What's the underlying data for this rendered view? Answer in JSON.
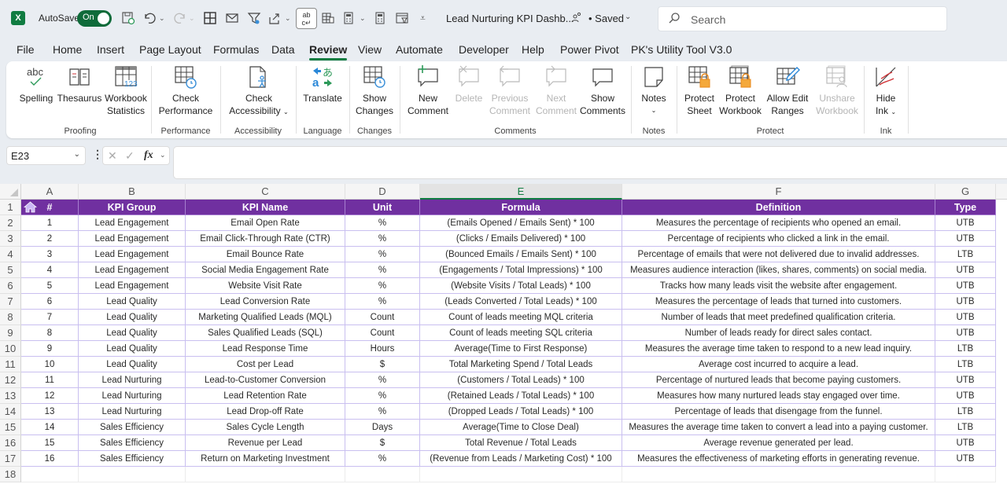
{
  "titlebar": {
    "app_icon": "excel-logo-icon",
    "app_letter": "X",
    "autosave_label": "AutoSave",
    "autosave_state": "On",
    "document_title": "Lead Nurturing KPI Dashb...",
    "save_status": "• Saved",
    "search_placeholder": "Search"
  },
  "tabs": [
    {
      "label": "File"
    },
    {
      "label": "Home"
    },
    {
      "label": "Insert"
    },
    {
      "label": "Page Layout"
    },
    {
      "label": "Formulas"
    },
    {
      "label": "Data"
    },
    {
      "label": "Review",
      "active": true
    },
    {
      "label": "View"
    },
    {
      "label": "Automate"
    },
    {
      "label": "Developer"
    },
    {
      "label": "Help"
    },
    {
      "label": "Power Pivot"
    },
    {
      "label": "PK's Utility Tool V3.0"
    }
  ],
  "ribbon": {
    "groups": {
      "proofing": "Proofing",
      "performance": "Performance",
      "accessibility": "Accessibility",
      "language": "Language",
      "changes": "Changes",
      "comments": "Comments",
      "notes": "Notes",
      "protect": "Protect",
      "ink": "Ink"
    },
    "buttons": {
      "spelling": "Spelling",
      "thesaurus": "Thesaurus",
      "workbook_statistics_1": "Workbook",
      "workbook_statistics_2": "Statistics",
      "check_performance_1": "Check",
      "check_performance_2": "Performance",
      "check_accessibility_1": "Check",
      "check_accessibility_2": "Accessibility",
      "translate": "Translate",
      "show_changes_1": "Show",
      "show_changes_2": "Changes",
      "new_comment_1": "New",
      "new_comment_2": "Comment",
      "delete_comment": "Delete",
      "previous_comment_1": "Previous",
      "previous_comment_2": "Comment",
      "next_comment_1": "Next",
      "next_comment_2": "Comment",
      "show_comments_1": "Show",
      "show_comments_2": "Comments",
      "notes": "Notes",
      "protect_sheet_1": "Protect",
      "protect_sheet_2": "Sheet",
      "protect_workbook_1": "Protect",
      "protect_workbook_2": "Workbook",
      "allow_edit_ranges_1": "Allow Edit",
      "allow_edit_ranges_2": "Ranges",
      "unshare_workbook_1": "Unshare",
      "unshare_workbook_2": "Workbook",
      "hide_ink_1": "Hide",
      "hide_ink_2": "Ink"
    }
  },
  "formula_bar": {
    "name_box": "E23",
    "formula": ""
  },
  "sheet": {
    "column_letters": [
      "A",
      "B",
      "C",
      "D",
      "E",
      "F",
      "G"
    ],
    "selected_column": "E",
    "row_numbers": [
      "1",
      "2",
      "3",
      "4",
      "5",
      "6",
      "7",
      "8",
      "9",
      "10",
      "11",
      "12",
      "13",
      "14",
      "15",
      "16",
      "17",
      "18"
    ],
    "header_color": "#7030a0",
    "headers": [
      "#",
      "KPI Group",
      "KPI Name",
      "Unit",
      "Formula",
      "Definition",
      "Type"
    ],
    "rows": [
      [
        "1",
        "Lead Engagement",
        "Email Open Rate",
        "%",
        "(Emails Opened / Emails Sent) * 100",
        "Measures the percentage of recipients who opened an email.",
        "UTB"
      ],
      [
        "2",
        "Lead Engagement",
        "Email Click-Through Rate (CTR)",
        "%",
        "(Clicks / Emails Delivered) * 100",
        "Percentage of recipients who clicked a link in the email.",
        "UTB"
      ],
      [
        "3",
        "Lead Engagement",
        "Email Bounce Rate",
        "%",
        "(Bounced Emails / Emails Sent) * 100",
        "Percentage of emails that were not delivered due to invalid addresses.",
        "LTB"
      ],
      [
        "4",
        "Lead Engagement",
        "Social Media Engagement Rate",
        "%",
        "(Engagements / Total Impressions) * 100",
        "Measures audience interaction (likes, shares, comments) on social media.",
        "UTB"
      ],
      [
        "5",
        "Lead Engagement",
        "Website Visit Rate",
        "%",
        "(Website Visits / Total Leads) * 100",
        "Tracks how many leads visit the website after engagement.",
        "UTB"
      ],
      [
        "6",
        "Lead Quality",
        "Lead Conversion Rate",
        "%",
        "(Leads Converted / Total Leads) * 100",
        "Measures the percentage of leads that turned into customers.",
        "UTB"
      ],
      [
        "7",
        "Lead Quality",
        "Marketing Qualified Leads (MQL)",
        "Count",
        "Count of leads meeting MQL criteria",
        "Number of leads that meet predefined qualification criteria.",
        "UTB"
      ],
      [
        "8",
        "Lead Quality",
        "Sales Qualified Leads (SQL)",
        "Count",
        "Count of leads meeting SQL criteria",
        "Number of leads ready for direct sales contact.",
        "UTB"
      ],
      [
        "9",
        "Lead Quality",
        "Lead Response Time",
        "Hours",
        "Average(Time to First Response)",
        "Measures the average time taken to respond to a new lead inquiry.",
        "LTB"
      ],
      [
        "10",
        "Lead Quality",
        "Cost per Lead",
        "$",
        "Total Marketing Spend / Total Leads",
        "Average cost incurred to acquire a lead.",
        "LTB"
      ],
      [
        "11",
        "Lead Nurturing",
        "Lead-to-Customer Conversion",
        "%",
        "(Customers / Total Leads) * 100",
        "Percentage of nurtured leads that become paying customers.",
        "UTB"
      ],
      [
        "12",
        "Lead Nurturing",
        "Lead Retention Rate",
        "%",
        "(Retained Leads / Total Leads) * 100",
        "Measures how many nurtured leads stay engaged over time.",
        "UTB"
      ],
      [
        "13",
        "Lead Nurturing",
        "Lead Drop-off Rate",
        "%",
        "(Dropped Leads / Total Leads) * 100",
        "Percentage of leads that disengage from the funnel.",
        "LTB"
      ],
      [
        "14",
        "Sales Efficiency",
        "Sales Cycle Length",
        "Days",
        "Average(Time to Close Deal)",
        "Measures the average time taken to convert a lead into a paying customer.",
        "LTB"
      ],
      [
        "15",
        "Sales Efficiency",
        "Revenue per Lead",
        "$",
        "Total Revenue / Total Leads",
        "Average revenue generated per lead.",
        "UTB"
      ],
      [
        "16",
        "Sales Efficiency",
        "Return on Marketing Investment",
        "%",
        "(Revenue from Leads / Marketing Cost) * 100",
        "Measures the effectiveness of marketing efforts in generating revenue.",
        "UTB"
      ]
    ]
  }
}
